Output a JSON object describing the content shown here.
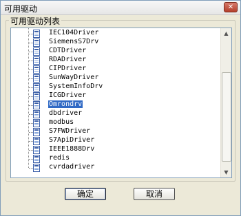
{
  "window": {
    "title": "可用驱动",
    "close_label": "✕"
  },
  "group": {
    "title": "可用驱动列表"
  },
  "tree": {
    "items": [
      {
        "label": "IEC104Driver"
      },
      {
        "label": "SiemensS7Drv"
      },
      {
        "label": "CDTDriver"
      },
      {
        "label": "RDADriver"
      },
      {
        "label": "CIPDriver"
      },
      {
        "label": "SunWayDriver"
      },
      {
        "label": "SystemInfoDrv"
      },
      {
        "label": "ICGDriver"
      },
      {
        "label": "Omrondrv",
        "selected": true
      },
      {
        "label": "dbdriver"
      },
      {
        "label": "modbus"
      },
      {
        "label": "S7FWDriver"
      },
      {
        "label": "S7ApiDriver"
      },
      {
        "label": "IEEE1888Drv"
      },
      {
        "label": "redis"
      },
      {
        "label": "cvrdadriver"
      }
    ]
  },
  "buttons": {
    "ok_label": "确定",
    "cancel_label": "取消"
  }
}
